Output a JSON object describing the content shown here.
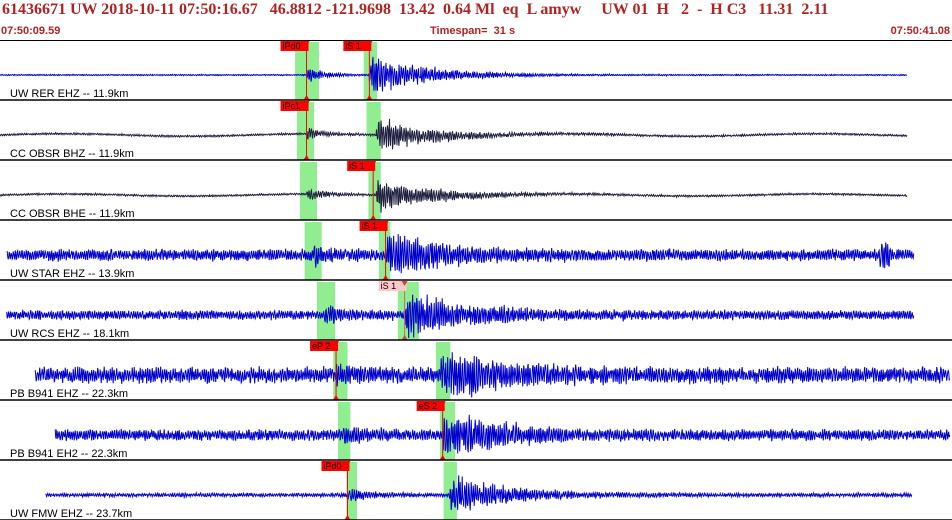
{
  "header": {
    "title": "61436671 UW 2018-10-11 07:50:16.67   46.8812 -121.9698  13.42  0.64 Ml  eq  L amyw     UW 01  H   2  -  H C3   11.31  2.11",
    "start_time": "07:50:09.59",
    "timespan": "Timespan=  31 s",
    "end_time": "07:50:41.08"
  },
  "colors": {
    "header_text": "#b22222",
    "trace_blue": "#0000cc",
    "trace_dark": "#202040",
    "window_green": "#90ee90",
    "pick_red": "#ff0000",
    "pick_pale": "#ffc8c8",
    "separator": "#000000"
  },
  "traces": [
    {
      "label": "UW RER EHZ -- 11.9km",
      "color": "blue",
      "start": 0.0,
      "end": 0.953,
      "noise": 0.03,
      "p": 0.322,
      "s": 0.388,
      "amp": 0.95,
      "picks": [
        {
          "text": "iPd0",
          "pos": 0.322,
          "style": "red"
        },
        {
          "text": "iS 1",
          "pos": 0.388,
          "style": "red"
        }
      ],
      "windows": [
        [
          0.31,
          0.335
        ],
        [
          0.382,
          0.396
        ]
      ]
    },
    {
      "label": "CC OBSR BHZ -- 11.9km",
      "color": "dark",
      "start": 0.0,
      "end": 0.953,
      "noise": 0.06,
      "p": 0.322,
      "s": 0.395,
      "amp": 0.75,
      "drift": 0.06,
      "picks": [
        {
          "text": "iPc1",
          "pos": 0.322,
          "style": "red"
        }
      ],
      "windows": [
        [
          0.312,
          0.33
        ],
        [
          0.385,
          0.4
        ]
      ]
    },
    {
      "label": "CC OBSR BHE -- 11.9km",
      "color": "dark",
      "start": 0.0,
      "end": 0.953,
      "noise": 0.06,
      "p": 0.322,
      "s": 0.395,
      "amp": 0.75,
      "drift": 0.05,
      "picks": [
        {
          "text": "iS 1",
          "pos": 0.392,
          "style": "red"
        }
      ],
      "windows": [
        [
          0.315,
          0.333
        ],
        [
          0.387,
          0.4
        ]
      ]
    },
    {
      "label": "UW STAR EHZ -- 13.9km",
      "color": "blue",
      "start": 0.007,
      "end": 0.96,
      "noise": 0.28,
      "p": 0.33,
      "s": 0.405,
      "amp": 0.9,
      "blip": 0.93,
      "picks": [
        {
          "text": "iS 1",
          "pos": 0.405,
          "style": "red"
        }
      ],
      "windows": [
        [
          0.32,
          0.338
        ],
        [
          0.398,
          0.41
        ]
      ]
    },
    {
      "label": "UW RCS EHZ -- 18.1km",
      "color": "blue",
      "start": 0.007,
      "end": 0.96,
      "noise": 0.22,
      "p": 0.34,
      "s": 0.425,
      "amp": 0.95,
      "picks": [
        {
          "text": "iS 1",
          "pos": 0.425,
          "style": "pale"
        }
      ],
      "windows": [
        [
          0.333,
          0.352
        ],
        [
          0.418,
          0.44
        ]
      ]
    },
    {
      "label": "PB B941 EHZ -- 22.3km",
      "color": "blue",
      "start": 0.037,
      "end": 0.998,
      "noise": 0.38,
      "p": 0.353,
      "s": 0.463,
      "amp": 0.95,
      "picks": [
        {
          "text": "eP 2",
          "pos": 0.353,
          "style": "red"
        }
      ],
      "windows": [
        [
          0.35,
          0.365
        ],
        [
          0.458,
          0.473
        ]
      ]
    },
    {
      "label": "PB B941 EH2 -- 22.3km",
      "color": "blue",
      "start": 0.058,
      "end": 0.998,
      "noise": 0.26,
      "p": 0.36,
      "s": 0.465,
      "amp": 0.95,
      "picks": [
        {
          "text": "eS 2",
          "pos": 0.465,
          "style": "red"
        }
      ],
      "windows": [
        [
          0.355,
          0.368
        ],
        [
          0.462,
          0.478
        ]
      ]
    },
    {
      "label": "UW FMW EHZ -- 23.7km",
      "color": "blue",
      "start": 0.048,
      "end": 0.958,
      "noise": 0.1,
      "p": 0.365,
      "s": 0.472,
      "amp": 0.85,
      "picks": [
        {
          "text": "iPd0",
          "pos": 0.365,
          "style": "red"
        }
      ],
      "windows": [
        [
          0.364,
          0.375
        ],
        [
          0.466,
          0.48
        ]
      ]
    }
  ]
}
